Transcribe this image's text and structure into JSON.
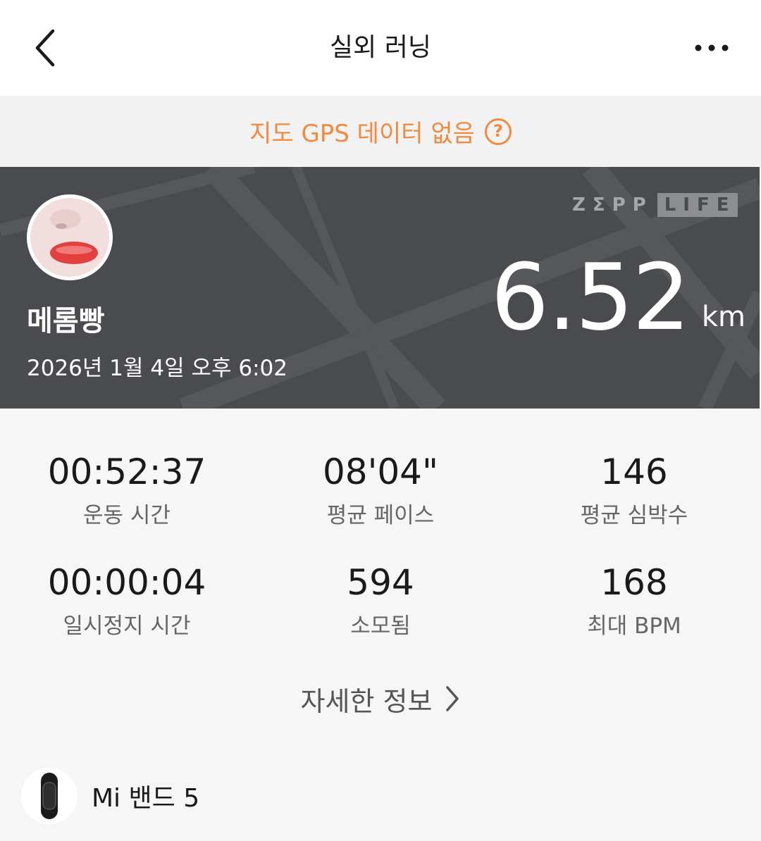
{
  "header": {
    "title": "실외 러닝",
    "back_icon": "chevron-left-icon",
    "more_icon": "more-horizontal-icon"
  },
  "gps_banner": {
    "text": "지도 GPS 데이터 없음",
    "help_symbol": "?",
    "color": "#f08a3e"
  },
  "summary": {
    "username": "메롬빵",
    "datetime": "2026년 1월 4일 오후 6:02",
    "brand_primary": "ZΣPP",
    "brand_secondary": "LIFE",
    "distance": "6.52",
    "distance_unit": "km",
    "background_color": "#4a4b4f"
  },
  "stats": [
    {
      "value": "00:52:37",
      "label": "운동 시간"
    },
    {
      "value": "08'04\"",
      "label": "평균 페이스"
    },
    {
      "value": "146",
      "label": "평균 심박수"
    },
    {
      "value": "00:00:04",
      "label": "일시정지 시간"
    },
    {
      "value": "594",
      "label": "소모됨"
    },
    {
      "value": "168",
      "label": "최대 BPM"
    }
  ],
  "detail_link": {
    "label": "자세한 정보",
    "icon": "chevron-right-icon"
  },
  "device": {
    "name": "Mi 밴드 5",
    "icon": "band-icon"
  }
}
